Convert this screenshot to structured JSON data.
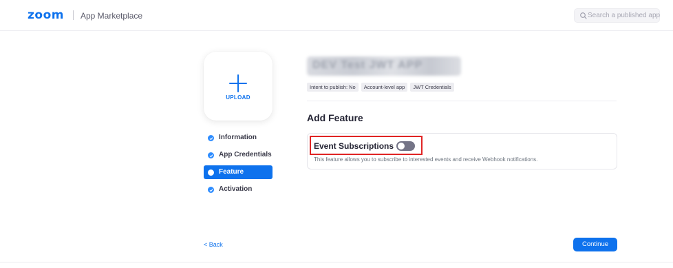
{
  "header": {
    "logo": "zoom",
    "title": "App Marketplace",
    "search_placeholder": "Search a published app"
  },
  "upload": {
    "label": "UPLOAD"
  },
  "steps": [
    {
      "label": "Information",
      "state": "done"
    },
    {
      "label": "App Credentials",
      "state": "done"
    },
    {
      "label": "Feature",
      "state": "active"
    },
    {
      "label": "Activation",
      "state": "done"
    }
  ],
  "app": {
    "name": "DEV Test JWT APP",
    "tags": [
      "Intent to publish: No",
      "Account-level app",
      "JWT Credentials"
    ]
  },
  "main": {
    "section_title": "Add Feature",
    "feature": {
      "name": "Event Subscriptions",
      "enabled": false,
      "description": "This feature allows you to subscribe to interested events and receive Webhook notifications."
    }
  },
  "footer": {
    "back": "< Back",
    "continue": "Continue"
  },
  "colors": {
    "brand": "#0e72ed",
    "highlight": "#e02424",
    "toggle_off": "#747487"
  }
}
